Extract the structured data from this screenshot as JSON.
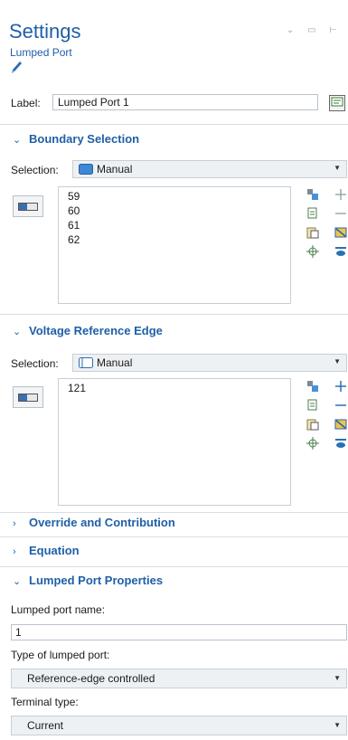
{
  "header": {
    "title": "Settings",
    "subtitle": "Lumped Port",
    "window_controls": "⌄ ▭ ⊢"
  },
  "label_row": {
    "label": "Label:",
    "value": "Lumped Port 1"
  },
  "sections": {
    "boundary": {
      "heading": "Boundary Selection",
      "selection_label": "Selection:",
      "selection_value": "Manual",
      "items": [
        "59",
        "60",
        "61",
        "62"
      ]
    },
    "voltage": {
      "heading": "Voltage Reference Edge",
      "selection_label": "Selection:",
      "selection_value": "Manual",
      "items": [
        "121"
      ]
    },
    "override": {
      "heading": "Override and Contribution"
    },
    "equation": {
      "heading": "Equation"
    },
    "lumped": {
      "heading": "Lumped Port Properties",
      "name_label": "Lumped port name:",
      "name_value": "1",
      "type_label": "Type of lumped port:",
      "type_value": "Reference-edge controlled",
      "terminal_label": "Terminal type:",
      "terminal_value": "Current"
    }
  },
  "colors": {
    "accent": "#1f5fa8",
    "divider": "#d9dee3"
  }
}
